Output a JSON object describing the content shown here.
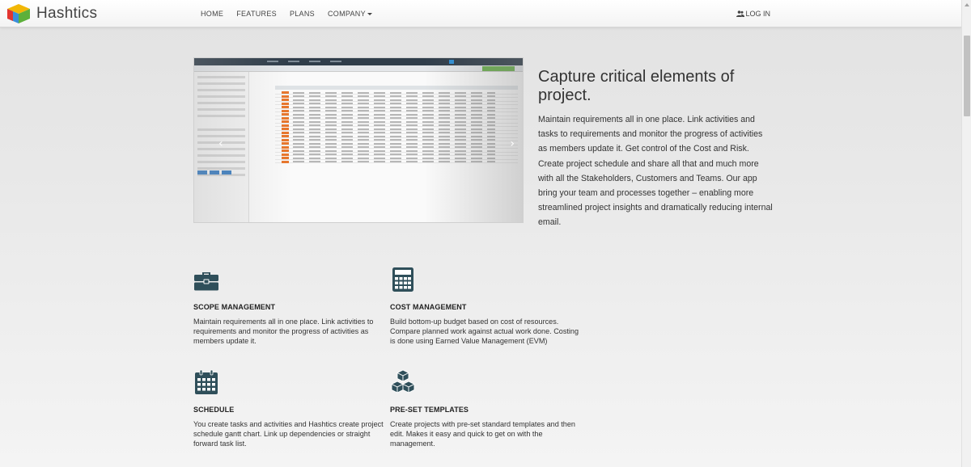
{
  "brand": {
    "name": "Hashtics"
  },
  "nav": {
    "items": [
      "HOME",
      "FEATURES",
      "PLANS",
      "COMPANY"
    ],
    "login": "LOG IN"
  },
  "hero": {
    "title": "Capture critical elements of project.",
    "body": "Maintain requirements all in one place. Link activities and tasks to requirements and monitor the progress of activities as members update it. Get control of the Cost and Risk. Create project schedule and share all that and much more with all the Stakeholders, Customers and Teams. Our app bring your team and processes together – enabling more streamlined project insights and dramatically reducing internal email."
  },
  "features": [
    {
      "title": "SCOPE MANAGEMENT",
      "icon": "briefcase-icon",
      "text": "Maintain requirements all in one place. Link activities to requirements and monitor the progress of activities as members update it."
    },
    {
      "title": "COST MANAGEMENT",
      "icon": "calculator-icon",
      "text": "Build bottom-up budget based on cost of resources. Compare planned work against actual work done. Costing is done using Earned Value Management (EVM)"
    },
    {
      "title": "SCHEDULE",
      "icon": "calendar-icon",
      "text": "You create tasks and activities and Hashtics create project schedule gantt chart. Link up dependencies or straight forward task list."
    },
    {
      "title": "PRE-SET TEMPLATES",
      "icon": "cubes-icon",
      "text": "Create projects with pre-set standard templates and then edit. Makes it easy and quick to get on with the management."
    }
  ],
  "colors": {
    "icon": "#2f4f5a",
    "accent": "#e8762b",
    "navy": "#2f3d4a"
  }
}
